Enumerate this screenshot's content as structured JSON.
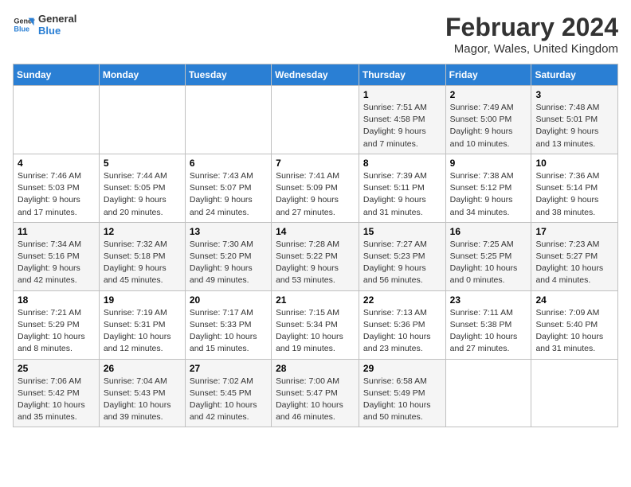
{
  "header": {
    "logo_line1": "General",
    "logo_line2": "Blue",
    "main_title": "February 2024",
    "subtitle": "Magor, Wales, United Kingdom"
  },
  "days_of_week": [
    "Sunday",
    "Monday",
    "Tuesday",
    "Wednesday",
    "Thursday",
    "Friday",
    "Saturday"
  ],
  "weeks": [
    [
      {
        "day": "",
        "info": ""
      },
      {
        "day": "",
        "info": ""
      },
      {
        "day": "",
        "info": ""
      },
      {
        "day": "",
        "info": ""
      },
      {
        "day": "1",
        "info": "Sunrise: 7:51 AM\nSunset: 4:58 PM\nDaylight: 9 hours\nand 7 minutes."
      },
      {
        "day": "2",
        "info": "Sunrise: 7:49 AM\nSunset: 5:00 PM\nDaylight: 9 hours\nand 10 minutes."
      },
      {
        "day": "3",
        "info": "Sunrise: 7:48 AM\nSunset: 5:01 PM\nDaylight: 9 hours\nand 13 minutes."
      }
    ],
    [
      {
        "day": "4",
        "info": "Sunrise: 7:46 AM\nSunset: 5:03 PM\nDaylight: 9 hours\nand 17 minutes."
      },
      {
        "day": "5",
        "info": "Sunrise: 7:44 AM\nSunset: 5:05 PM\nDaylight: 9 hours\nand 20 minutes."
      },
      {
        "day": "6",
        "info": "Sunrise: 7:43 AM\nSunset: 5:07 PM\nDaylight: 9 hours\nand 24 minutes."
      },
      {
        "day": "7",
        "info": "Sunrise: 7:41 AM\nSunset: 5:09 PM\nDaylight: 9 hours\nand 27 minutes."
      },
      {
        "day": "8",
        "info": "Sunrise: 7:39 AM\nSunset: 5:11 PM\nDaylight: 9 hours\nand 31 minutes."
      },
      {
        "day": "9",
        "info": "Sunrise: 7:38 AM\nSunset: 5:12 PM\nDaylight: 9 hours\nand 34 minutes."
      },
      {
        "day": "10",
        "info": "Sunrise: 7:36 AM\nSunset: 5:14 PM\nDaylight: 9 hours\nand 38 minutes."
      }
    ],
    [
      {
        "day": "11",
        "info": "Sunrise: 7:34 AM\nSunset: 5:16 PM\nDaylight: 9 hours\nand 42 minutes."
      },
      {
        "day": "12",
        "info": "Sunrise: 7:32 AM\nSunset: 5:18 PM\nDaylight: 9 hours\nand 45 minutes."
      },
      {
        "day": "13",
        "info": "Sunrise: 7:30 AM\nSunset: 5:20 PM\nDaylight: 9 hours\nand 49 minutes."
      },
      {
        "day": "14",
        "info": "Sunrise: 7:28 AM\nSunset: 5:22 PM\nDaylight: 9 hours\nand 53 minutes."
      },
      {
        "day": "15",
        "info": "Sunrise: 7:27 AM\nSunset: 5:23 PM\nDaylight: 9 hours\nand 56 minutes."
      },
      {
        "day": "16",
        "info": "Sunrise: 7:25 AM\nSunset: 5:25 PM\nDaylight: 10 hours\nand 0 minutes."
      },
      {
        "day": "17",
        "info": "Sunrise: 7:23 AM\nSunset: 5:27 PM\nDaylight: 10 hours\nand 4 minutes."
      }
    ],
    [
      {
        "day": "18",
        "info": "Sunrise: 7:21 AM\nSunset: 5:29 PM\nDaylight: 10 hours\nand 8 minutes."
      },
      {
        "day": "19",
        "info": "Sunrise: 7:19 AM\nSunset: 5:31 PM\nDaylight: 10 hours\nand 12 minutes."
      },
      {
        "day": "20",
        "info": "Sunrise: 7:17 AM\nSunset: 5:33 PM\nDaylight: 10 hours\nand 15 minutes."
      },
      {
        "day": "21",
        "info": "Sunrise: 7:15 AM\nSunset: 5:34 PM\nDaylight: 10 hours\nand 19 minutes."
      },
      {
        "day": "22",
        "info": "Sunrise: 7:13 AM\nSunset: 5:36 PM\nDaylight: 10 hours\nand 23 minutes."
      },
      {
        "day": "23",
        "info": "Sunrise: 7:11 AM\nSunset: 5:38 PM\nDaylight: 10 hours\nand 27 minutes."
      },
      {
        "day": "24",
        "info": "Sunrise: 7:09 AM\nSunset: 5:40 PM\nDaylight: 10 hours\nand 31 minutes."
      }
    ],
    [
      {
        "day": "25",
        "info": "Sunrise: 7:06 AM\nSunset: 5:42 PM\nDaylight: 10 hours\nand 35 minutes."
      },
      {
        "day": "26",
        "info": "Sunrise: 7:04 AM\nSunset: 5:43 PM\nDaylight: 10 hours\nand 39 minutes."
      },
      {
        "day": "27",
        "info": "Sunrise: 7:02 AM\nSunset: 5:45 PM\nDaylight: 10 hours\nand 42 minutes."
      },
      {
        "day": "28",
        "info": "Sunrise: 7:00 AM\nSunset: 5:47 PM\nDaylight: 10 hours\nand 46 minutes."
      },
      {
        "day": "29",
        "info": "Sunrise: 6:58 AM\nSunset: 5:49 PM\nDaylight: 10 hours\nand 50 minutes."
      },
      {
        "day": "",
        "info": ""
      },
      {
        "day": "",
        "info": ""
      }
    ]
  ]
}
